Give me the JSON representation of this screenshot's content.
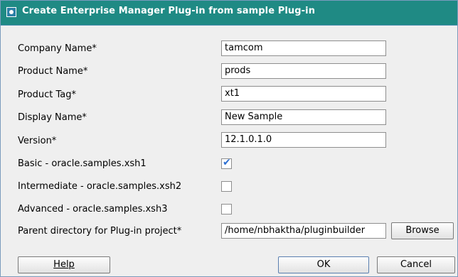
{
  "window": {
    "title": "Create Enterprise Manager Plug-in from sample Plug-in"
  },
  "form": {
    "company_name": {
      "label": "Company Name*",
      "value": "tamcom"
    },
    "product_name": {
      "label": "Product Name*",
      "value": "prods"
    },
    "product_tag": {
      "label": "Product Tag*",
      "value": "xt1"
    },
    "display_name": {
      "label": "Display Name*",
      "value": "New Sample"
    },
    "version": {
      "label": "Version*",
      "value": "12.1.0.1.0"
    },
    "basic": {
      "label": "Basic - oracle.samples.xsh1",
      "checked": true
    },
    "intermediate": {
      "label": "Intermediate - oracle.samples.xsh2",
      "checked": false
    },
    "advanced": {
      "label": "Advanced - oracle.samples.xsh3",
      "checked": false
    },
    "parent_dir": {
      "label": "Parent directory for Plug-in project*",
      "value": "/home/nbhaktha/pluginbuilder"
    },
    "browse_label": "Browse"
  },
  "buttons": {
    "help": "Help",
    "ok": "OK",
    "cancel": "Cancel"
  },
  "colors": {
    "titlebar": "#1f8a84",
    "check_tick": "#2d6fd1"
  }
}
